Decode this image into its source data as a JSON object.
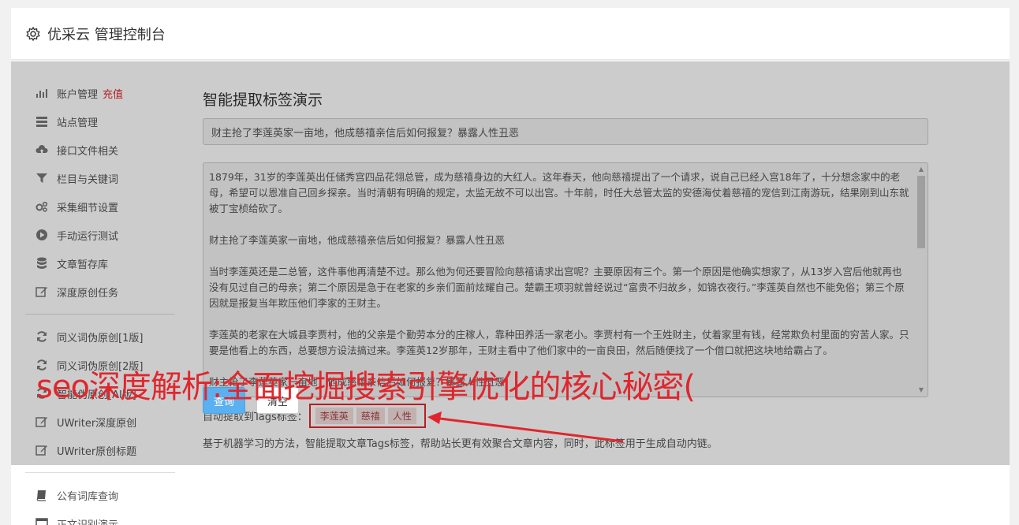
{
  "header": {
    "title": "优采云 管理控制台",
    "icon": "gear-icon"
  },
  "sidebar": {
    "items": [
      {
        "label": "账户管理",
        "badge": "充值",
        "icon": "bar-chart-icon"
      },
      {
        "label": "站点管理",
        "icon": "server-icon"
      },
      {
        "label": "接口文件相关",
        "icon": "cloud-upload-icon"
      },
      {
        "label": "栏目与关键词",
        "icon": "filter-icon"
      },
      {
        "label": "采集细节设置",
        "icon": "gears-icon"
      },
      {
        "label": "手动运行测试",
        "icon": "play-circle-icon"
      },
      {
        "label": "文章暂存库",
        "icon": "database-icon"
      },
      {
        "label": "深度原创任务",
        "icon": "edit-icon"
      }
    ],
    "items2": [
      {
        "label": "同义词伪原创[1版]",
        "icon": "refresh-icon"
      },
      {
        "label": "同义词伪原创[2版]",
        "icon": "refresh-icon"
      },
      {
        "label": "智能伪原创[AI版]",
        "icon": "refresh-icon"
      },
      {
        "label": "UWriter深度原创",
        "icon": "edit-icon"
      },
      {
        "label": "UWriter原创标题",
        "icon": "edit-icon"
      }
    ],
    "items3": [
      {
        "label": "公有词库查询",
        "icon": "book-icon"
      },
      {
        "label": "正文识别演示",
        "icon": "window-icon"
      }
    ]
  },
  "main": {
    "heading": "智能提取标签演示",
    "title_value": "财主抢了李莲英家一亩地，他成慈禧亲信后如何报复？暴露人性丑恶",
    "paragraphs": [
      "1879年，31岁的李莲英出任储秀宫四品花翎总管，成为慈禧身边的大红人。这年春天，他向慈禧提出了一个请求，说自己已经入宫18年了，十分想念家中的老母，希望可以恩准自己回乡探亲。当时清朝有明确的规定，太监无故不可以出宫。十年前，时任大总管太监的安德海仗着慈禧的宠信到江南游玩，结果刚到山东就被丁宝桢给砍了。",
      "财主抢了李莲英家一亩地，他成慈禧亲信后如何报复？暴露人性丑恶",
      "当时李莲英还是二总管，这件事他再清楚不过。那么他为何还要冒险向慈禧请求出宫呢？主要原因有三个。第一个原因是他确实想家了，从13岁入宫后他就再也没有见过自己的母亲；第二个原因是急于在老家的乡亲们面前炫耀自己。楚霸王项羽就曾经说过“富贵不归故乡，如锦衣夜行。”李莲英自然也不能免俗；第三个原因就是报复当年欺压他们李家的王财主。",
      "李莲英的老家在大城县李贾村，他的父亲是个勤劳本分的庄稼人，靠种田养活一家老小。李贾村有一个王姓财主，仗着家里有钱，经常欺负村里面的穷苦人家。只要是他看上的东西，总要想方设法搞过来。李莲英12岁那年，王财主看中了他们家中的一亩良田，然后随便找了一个借口就把这块地给霸占了。",
      "财主抢了李莲英家一亩地，他成慈禧亲信后如何报复？暴露人性丑恶"
    ],
    "tags_label": "自动提取到Tags标签：",
    "tags": [
      "李莲英",
      "慈禧",
      "人性"
    ],
    "description": "基于机器学习的方法，智能提取文章Tags标签，帮助站长更有效聚合文章内容，同时，此标签用于生成自动内链。",
    "query_button": "查询",
    "clear_button": "清空"
  },
  "watermark": "seo深度解析:全面挖掘搜索引擎优化的核心秘密(",
  "colors": {
    "accent": "#e0262d",
    "primary": "#5bb0ef"
  }
}
